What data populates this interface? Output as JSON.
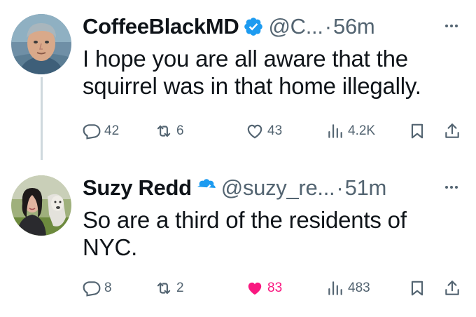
{
  "tweets": [
    {
      "name": "CoffeeBlackMD",
      "handle": "@C...",
      "separator": "·",
      "time": "56m",
      "text": "I hope you are all aware that the squirrel was in that home illegally.",
      "replies": "42",
      "reposts": "6",
      "likes": "43",
      "views": "4.2K",
      "liked": false
    },
    {
      "name": "Suzy Redd",
      "handle": "@suzy_re...",
      "separator": "·",
      "time": "51m",
      "text": "So are a third of the residents of NYC.",
      "replies": "8",
      "reposts": "2",
      "likes": "83",
      "views": "483",
      "liked": true
    }
  ],
  "colors": {
    "verified": "#1d9bf0",
    "muted": "#536471",
    "like_active": "#f91880",
    "thread_line": "#cfd9de"
  },
  "icons": [
    "verified-badge-icon",
    "more-icon",
    "reply-icon",
    "repost-icon",
    "like-icon",
    "views-icon",
    "bookmark-icon",
    "share-icon"
  ]
}
